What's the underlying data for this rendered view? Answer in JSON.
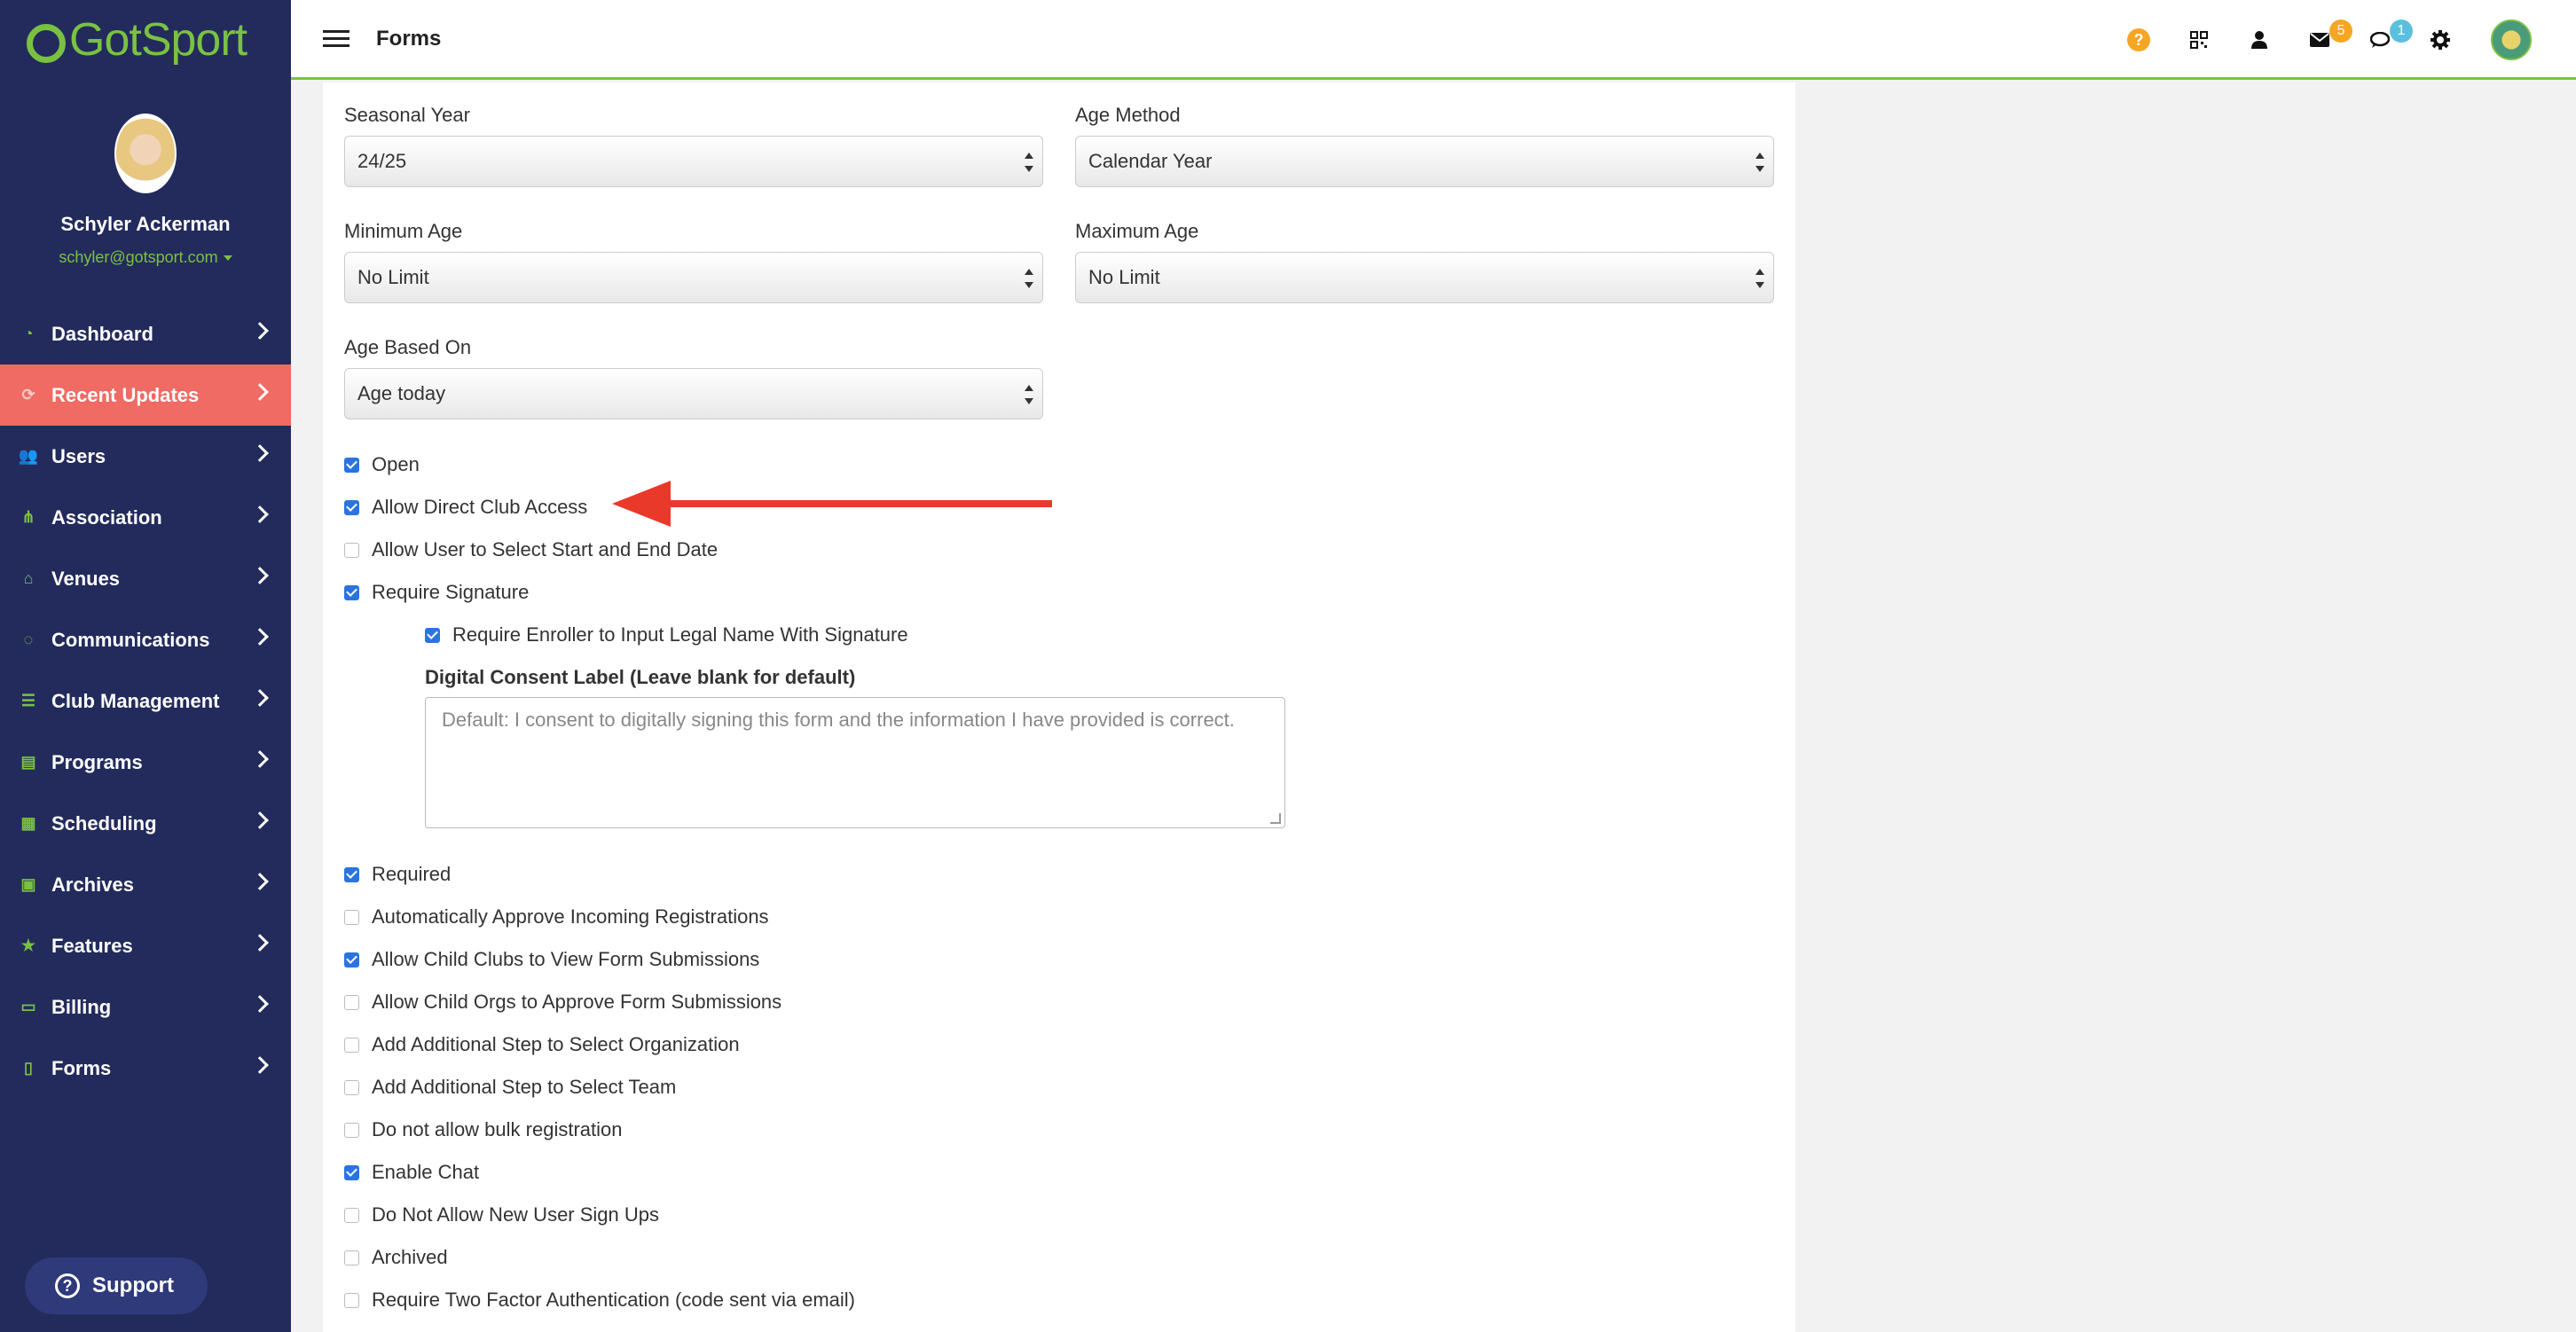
{
  "app": {
    "logo_text": "GotSport"
  },
  "profile": {
    "name": "Schyler Ackerman",
    "email": "schyler@gotsport.com"
  },
  "nav": [
    {
      "label": "Dashboard",
      "icon": "dashboard-icon",
      "glyph": "◔"
    },
    {
      "label": "Recent Updates",
      "icon": "refresh-icon",
      "glyph": "⟳",
      "active": true
    },
    {
      "label": "Users",
      "icon": "users-icon",
      "glyph": "👥"
    },
    {
      "label": "Association",
      "icon": "sitemap-icon",
      "glyph": "⋔"
    },
    {
      "label": "Venues",
      "icon": "home-icon",
      "glyph": "⌂"
    },
    {
      "label": "Communications",
      "icon": "chat-icon",
      "glyph": "◌"
    },
    {
      "label": "Club Management",
      "icon": "list-icon",
      "glyph": "☰"
    },
    {
      "label": "Programs",
      "icon": "file-icon",
      "glyph": "▤"
    },
    {
      "label": "Scheduling",
      "icon": "calendar-icon",
      "glyph": "▦"
    },
    {
      "label": "Archives",
      "icon": "archive-icon",
      "glyph": "▣"
    },
    {
      "label": "Features",
      "icon": "star-icon",
      "glyph": "★"
    },
    {
      "label": "Billing",
      "icon": "credit-card-icon",
      "glyph": "▭"
    },
    {
      "label": "Forms",
      "icon": "document-icon",
      "glyph": "▯"
    }
  ],
  "support": {
    "label": "Support"
  },
  "header": {
    "title": "Forms",
    "mail_count": "5",
    "chat_count": "1"
  },
  "form": {
    "seasonal_year": {
      "label": "Seasonal Year",
      "value": "24/25"
    },
    "age_method": {
      "label": "Age Method",
      "value": "Calendar Year"
    },
    "minimum_age": {
      "label": "Minimum Age",
      "value": "No Limit"
    },
    "maximum_age": {
      "label": "Maximum Age",
      "value": "No Limit"
    },
    "age_based_on": {
      "label": "Age Based On",
      "value": "Age today"
    },
    "checkboxes_top": [
      {
        "label": "Open",
        "checked": true
      },
      {
        "label": "Allow Direct Club Access",
        "checked": true
      },
      {
        "label": "Allow User to Select Start and End Date",
        "checked": false
      },
      {
        "label": "Require Signature",
        "checked": true
      }
    ],
    "require_legal_name": {
      "label": "Require Enroller to Input Legal Name With Signature",
      "checked": true
    },
    "digital_consent": {
      "label": "Digital Consent Label (Leave blank for default)",
      "placeholder": "Default: I consent to digitally signing this form and the information I have provided is correct."
    },
    "checkboxes_bottom": [
      {
        "label": "Required",
        "checked": true
      },
      {
        "label": "Automatically Approve Incoming Registrations",
        "checked": false
      },
      {
        "label": "Allow Child Clubs to View Form Submissions",
        "checked": true
      },
      {
        "label": "Allow Child Orgs to Approve Form Submissions",
        "checked": false
      },
      {
        "label": "Add Additional Step to Select Organization",
        "checked": false
      },
      {
        "label": "Add Additional Step to Select Team",
        "checked": false
      },
      {
        "label": "Do not allow bulk registration",
        "checked": false
      },
      {
        "label": "Enable Chat",
        "checked": true
      },
      {
        "label": "Do Not Allow New User Sign Ups",
        "checked": false
      },
      {
        "label": "Archived",
        "checked": false
      },
      {
        "label": "Require Two Factor Authentication (code sent via email)",
        "checked": false
      }
    ]
  },
  "colors": {
    "sidebar": "#232b5c",
    "accent_green": "#7ac143",
    "active_nav": "#ef6b64",
    "arrow": "#e8392b",
    "checkbox": "#2a74e0"
  }
}
